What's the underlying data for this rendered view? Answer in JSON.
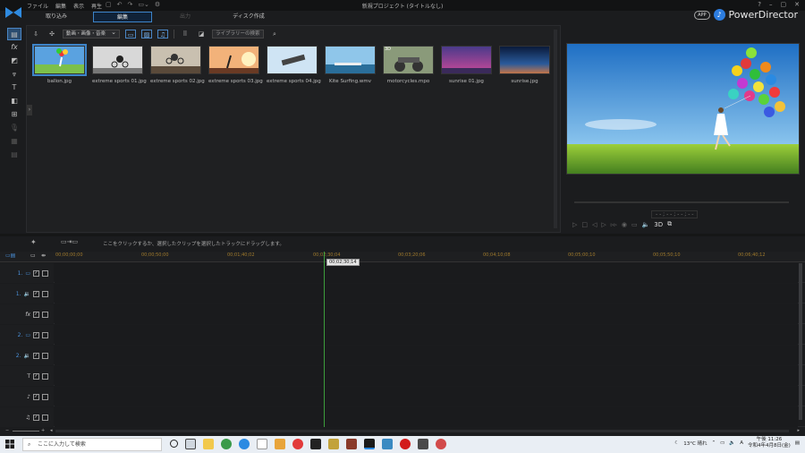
{
  "titlebar": {
    "menu": [
      "ファイル",
      "編集",
      "表示",
      "再生"
    ],
    "window_title": "新規プロジェクト (タイトルなし)",
    "help": "?"
  },
  "modes": {
    "capture": "取り込み",
    "edit": "編集",
    "produce": "出力",
    "disc": "ディスク作成"
  },
  "brand": {
    "app_badge": "APP",
    "name": "PowerDirector"
  },
  "library": {
    "filter": "動画・画像・音楽",
    "search_placeholder": "ライブラリーの検索",
    "items": [
      {
        "name": "ballon.jpg",
        "palette": [
          "#5aa2e0",
          "#7cc04a"
        ]
      },
      {
        "name": "extreme sports 01.jpg",
        "palette": [
          "#c9c9c9",
          "#555"
        ]
      },
      {
        "name": "extreme sports 02.jpg",
        "palette": [
          "#d9d0c0",
          "#4a3a2a"
        ]
      },
      {
        "name": "extreme sports 03.jpg",
        "palette": [
          "#f2b27a",
          "#6a3a24"
        ]
      },
      {
        "name": "extreme sports 04.jpg",
        "palette": [
          "#cfe4f4",
          "#8aa6c0"
        ]
      },
      {
        "name": "Kite Surfing.wmv",
        "palette": [
          "#8fc6ea",
          "#2a6e9a"
        ]
      },
      {
        "name": "motorcycles.mpo",
        "palette": [
          "#8a9a7a",
          "#3a3a3a"
        ]
      },
      {
        "name": "sunrise 01.jpg",
        "palette": [
          "#d24a9a",
          "#4a3a8a"
        ]
      },
      {
        "name": "sunrise.jpg",
        "palette": [
          "#2a4a7a",
          "#0a1a3a"
        ]
      }
    ],
    "thumb_badge": "3D"
  },
  "preview": {
    "timecode": "- - ; - - ; - - ; - -",
    "badge_3d": "3D"
  },
  "timeline": {
    "hint": "ここをクリックするか、選択したクリップを選択したトラックにドラッグします。",
    "ruler": [
      "00;00;00;00",
      "00;00;50;00",
      "00;01;40;02",
      "00;02;30;04",
      "00;03;20;06",
      "00;04;10;08",
      "00;05;00;10",
      "00;05;50;10",
      "00;06;40;12"
    ],
    "playhead_time": "00;02;30;14",
    "tracks": [
      {
        "label": "1.",
        "icon": "video-track-icon"
      },
      {
        "label": "1.",
        "icon": "audio-track-icon"
      },
      {
        "label": "fx",
        "icon": "fx-track-icon"
      },
      {
        "label": "2.",
        "icon": "video-track-icon"
      },
      {
        "label": "2.",
        "icon": "audio-track-icon"
      },
      {
        "label": "T",
        "icon": "title-track-icon"
      },
      {
        "label": "♪",
        "icon": "voice-track-icon"
      },
      {
        "label": "♫",
        "icon": "music-track-icon"
      }
    ]
  },
  "taskbar": {
    "search_placeholder": "ここに入力して検索",
    "weather": "13°C 晴れ",
    "ime": "A",
    "time": "午後 11:26",
    "date": "令和4年4月8日(金)"
  }
}
